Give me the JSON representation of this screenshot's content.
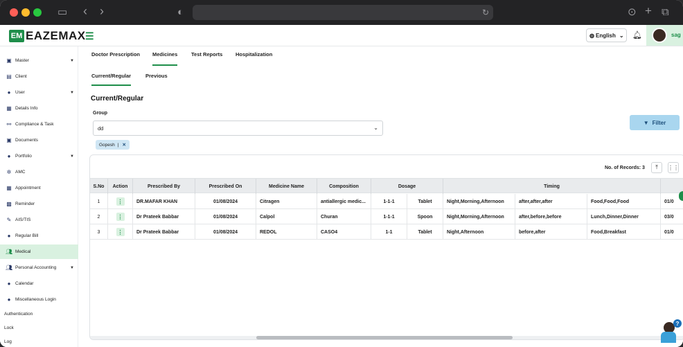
{
  "app": {
    "logo_mark": "EM",
    "logo_text": "EAZEMAX",
    "language": "English",
    "user_name": "sag"
  },
  "sidebar": {
    "items": [
      {
        "label": "Master",
        "icon": "folder-icon",
        "caret": true
      },
      {
        "label": "Client",
        "icon": "id-card-icon",
        "caret": false
      },
      {
        "label": "User",
        "icon": "user-icon",
        "caret": true
      },
      {
        "label": "Details Info",
        "icon": "document-icon",
        "caret": false
      },
      {
        "label": "Compliance & Task",
        "icon": "link-icon",
        "caret": false
      },
      {
        "label": "Documents",
        "icon": "folder-icon",
        "caret": false
      },
      {
        "label": "Portfolio",
        "icon": "user-icon",
        "caret": true
      },
      {
        "label": "AMC",
        "icon": "settings-icon",
        "caret": false
      },
      {
        "label": "Appointment",
        "icon": "document-icon",
        "caret": false
      },
      {
        "label": "Reminder",
        "icon": "bell-icon",
        "caret": false
      },
      {
        "label": "AIS/TIS",
        "icon": "pen-icon",
        "caret": false
      },
      {
        "label": "Regular Bill",
        "icon": "user-icon",
        "caret": false
      },
      {
        "label": "Medical",
        "icon": "users-icon",
        "caret": false,
        "active": true
      },
      {
        "label": "Personal Accounting",
        "icon": "users-icon",
        "caret": true
      },
      {
        "label": "Calendar",
        "icon": "user-icon",
        "caret": false
      },
      {
        "label": "Miscellaneous Login",
        "icon": "user-icon",
        "caret": false
      },
      {
        "label": "Authentication",
        "icon": "",
        "caret": false
      },
      {
        "label": "Lock",
        "icon": "",
        "caret": false
      },
      {
        "label": "Log",
        "icon": "",
        "caret": false
      }
    ]
  },
  "tabs": [
    "Doctor Prescription",
    "Medicines",
    "Test Reports",
    "Hospitalization"
  ],
  "active_tab": "Medicines",
  "subtabs": [
    "Current/Regular",
    "Previous"
  ],
  "section_title": "Current/Regular",
  "group": {
    "label": "Group",
    "value": "dd",
    "chip": "Gopesh",
    "chip_sep": "|"
  },
  "filter_label": "Filter",
  "records_label": "No. of Records: 3",
  "table": {
    "headers": [
      "S.No",
      "Action",
      "Prescribed By",
      "Prescribed On",
      "Medicine Name",
      "Composition",
      "Dosage",
      "Timing",
      ""
    ],
    "rows": [
      [
        "1",
        "DR.MAFAR KHAN",
        "01/08/2024",
        "Citragen",
        "antiallergic medic...",
        "1-1-1",
        "Tablet",
        "Night,Morning,Afternoon",
        "after,after,after",
        "Food,Food,Food",
        "01/0"
      ],
      [
        "2",
        "Dr Prateek Babbar",
        "01/08/2024",
        "Calpol",
        "Churan",
        "1-1-1",
        "Spoon",
        "Night,Morning,Afternoon",
        "after,before,before",
        "Lunch,Dinner,Dinner",
        "03/0"
      ],
      [
        "3",
        "Dr Prateek Babbar",
        "01/08/2024",
        "REDOL",
        "CASO4",
        "1-1",
        "Tablet",
        "Night,Afternoon",
        "before,after",
        "Food,Breakfast",
        "01/0"
      ]
    ]
  },
  "colors": {
    "brand": "#1e8e4a",
    "active_bg": "#d9f1e0",
    "filter_bg": "#a9d6ef",
    "chip_bg": "#cfe6f4"
  }
}
